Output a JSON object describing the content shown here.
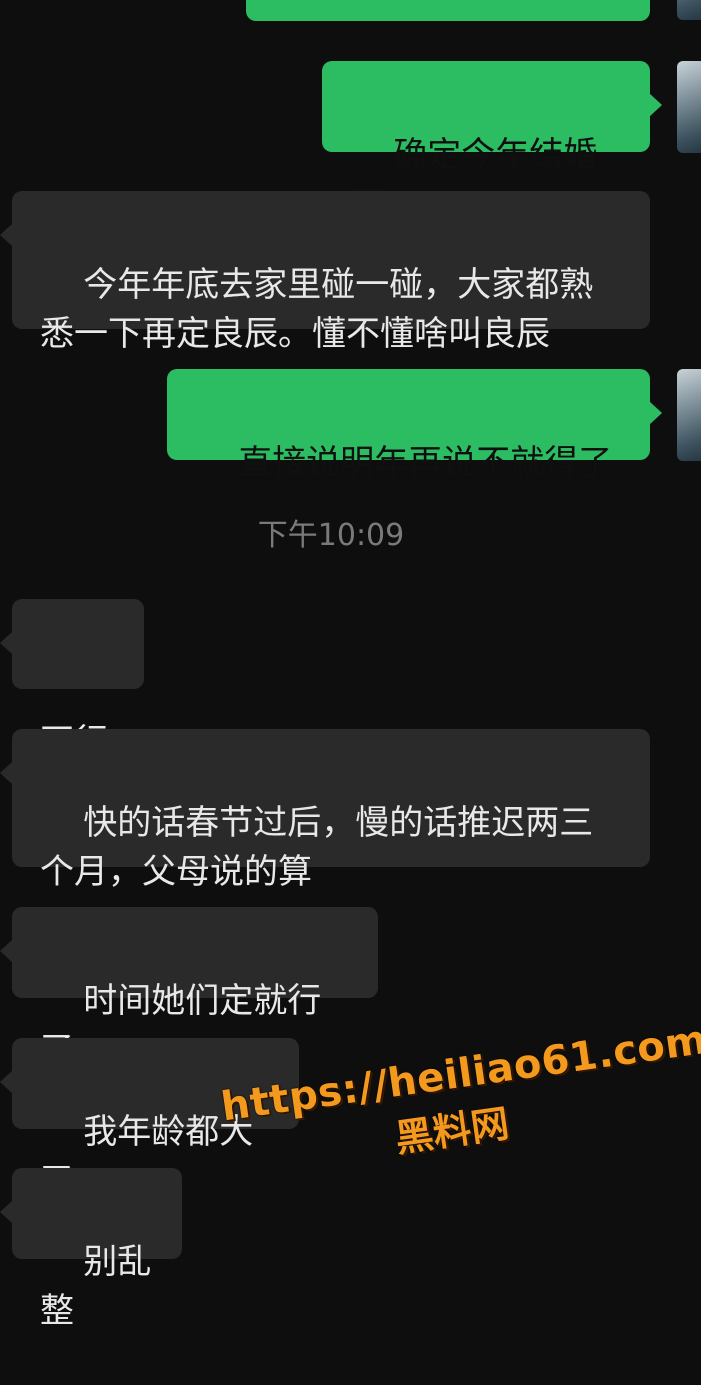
{
  "conversation": {
    "messages": [
      {
        "side": "out",
        "text": ""
      },
      {
        "side": "out",
        "text": "确定今年结婚吗"
      },
      {
        "side": "in",
        "text": "今年年底去家里碰一碰，大家都熟悉一下再定良辰。懂不懂啥叫良辰"
      },
      {
        "side": "out",
        "text": "直接说明年再说不就得了"
      },
      {
        "side": "in",
        "text": "不行"
      },
      {
        "side": "in",
        "text": "快的话春节过后，慢的话推迟两三个月，父母说的算"
      },
      {
        "side": "in",
        "text": "时间她们定就行了"
      },
      {
        "side": "in",
        "text": "我年龄都大了"
      },
      {
        "side": "in",
        "text": "别乱整"
      }
    ],
    "timestamp": "下午10:09"
  },
  "watermark": {
    "url": "https://heiliao61.com",
    "name": "黑料网"
  },
  "colors": {
    "background": "#0e0e0e",
    "outgoing_bubble": "#2cbd62",
    "incoming_bubble": "#2a2a2a",
    "watermark": "#f39a1e"
  }
}
